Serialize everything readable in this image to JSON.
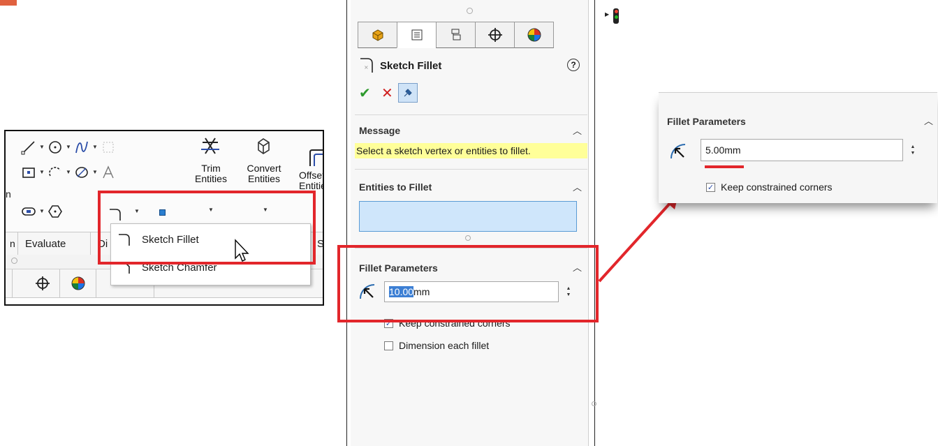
{
  "toolbar": {
    "buttons": {
      "trim_entities": "Trim Entities",
      "convert_entities": "Convert Entities",
      "offset_entities": "Offset Entities"
    },
    "tabs": [
      "Evaluate",
      "Di",
      "Si"
    ],
    "fillet_menu": {
      "items": [
        "Sketch Fillet",
        "Sketch Chamfer"
      ]
    }
  },
  "property_manager": {
    "title": "Sketch Fillet",
    "message": {
      "header": "Message",
      "text": "Select a sketch vertex or entities to fillet."
    },
    "entities": {
      "header": "Entities to Fillet"
    },
    "parameters": {
      "header": "Fillet Parameters",
      "radius_value": "10.00",
      "radius_unit": "mm",
      "keep_constrained": "Keep constrained corners",
      "keep_constrained_checked": true,
      "dimension_each": "Dimension each fillet",
      "dimension_each_checked": false
    }
  },
  "zoom_card": {
    "header": "Fillet Parameters",
    "radius_value": "5.00mm",
    "keep_constrained": "Keep constrained corners",
    "keep_constrained_checked": true
  },
  "colors": {
    "highlight_red": "#e2262b",
    "message_yellow": "#ffff99",
    "selection_blue": "#cfe6fb"
  }
}
